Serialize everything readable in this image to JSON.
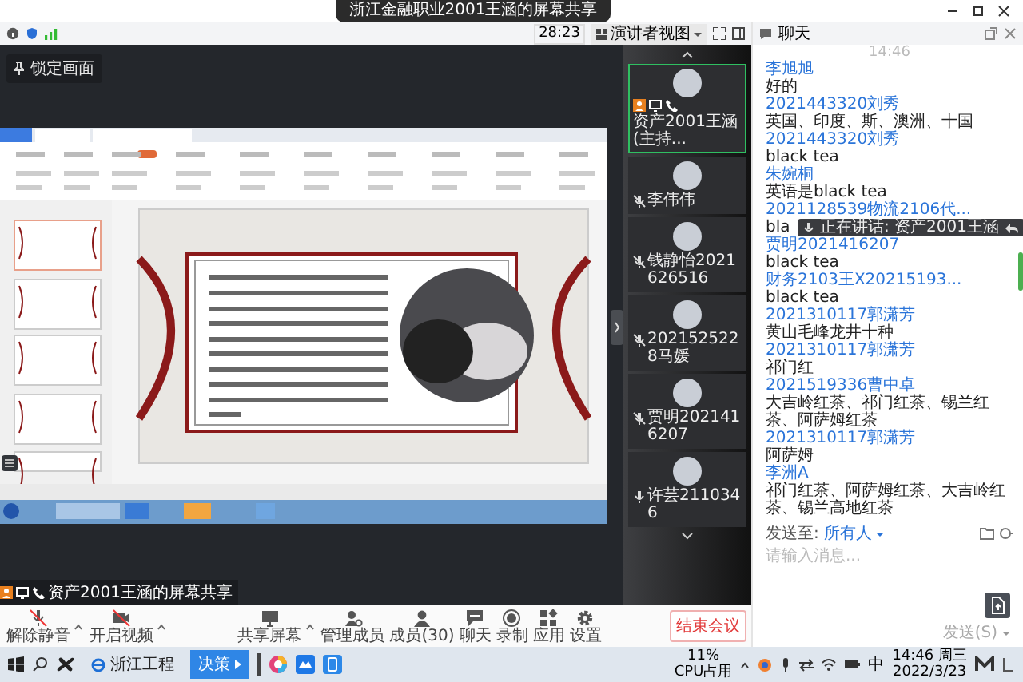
{
  "window": {
    "title": "浙江金融职业2001王涵的屏幕共享"
  },
  "toolbar": {
    "duration": "28:23",
    "view_button": "演讲者视图"
  },
  "stage": {
    "pin_label": "锁定画面",
    "share_label": "资产2001王涵的屏幕共享"
  },
  "participants": [
    {
      "name": "资产2001王涵(主持...",
      "host": true,
      "speaking": true,
      "muted": false
    },
    {
      "name": "李伟伟",
      "host": false,
      "speaking": false,
      "muted": true
    },
    {
      "name": "钱静怡2021626516",
      "host": false,
      "speaking": false,
      "muted": true
    },
    {
      "name": "2021525228马媛",
      "host": false,
      "speaking": false,
      "muted": true
    },
    {
      "name": "贾明2021416207",
      "host": false,
      "speaking": false,
      "muted": true
    },
    {
      "name": "许芸2110346",
      "host": false,
      "speaking": false,
      "muted": false
    }
  ],
  "chat": {
    "title": "聊天",
    "time": "14:46",
    "messages": [
      {
        "sender": "李旭旭",
        "text": "好的"
      },
      {
        "sender": "2021443320刘秀",
        "text": "英国、印度、斯、澳洲、十国"
      },
      {
        "sender": "2021443320刘秀",
        "text": "black tea"
      },
      {
        "sender": "朱婉桐",
        "text": "英语是black tea"
      },
      {
        "sender": "2021128539物流2106代...",
        "text": "bla",
        "notification": "正在讲话: 资产2001王涵"
      },
      {
        "sender": "贾明2021416207",
        "text": "black tea"
      },
      {
        "sender": "财务2103王X20215193...",
        "text": "black tea"
      },
      {
        "sender": "2021310117郭潇芳",
        "text": "黄山毛峰龙井十种"
      },
      {
        "sender": "2021310117郭潇芳",
        "text": "祁门红"
      },
      {
        "sender": "2021519336曹中卓",
        "text": "大吉岭红茶、祁门红茶、锡兰红茶、阿萨姆红茶"
      },
      {
        "sender": "2021310117郭潇芳",
        "text": "阿萨姆"
      },
      {
        "sender": "李洲A",
        "text": "祁门红茶、阿萨姆红茶、大吉岭红茶、锡兰高地红茶"
      }
    ],
    "recipient_label": "发送至:",
    "recipient": "所有人",
    "placeholder": "请输入消息...",
    "send_button": "发送(S)"
  },
  "controls": [
    {
      "kind": "mic_off",
      "label": "解除静音",
      "has_menu": true
    },
    {
      "kind": "video_off",
      "label": "开启视频",
      "has_menu": true
    },
    {
      "kind": "share",
      "label": "共享屏幕",
      "has_menu": true
    },
    {
      "kind": "manage",
      "label": "管理成员",
      "has_menu": false
    },
    {
      "kind": "members",
      "label": "成员(30)",
      "has_menu": false
    },
    {
      "kind": "chat",
      "label": "聊天",
      "has_menu": false
    },
    {
      "kind": "record",
      "label": "录制",
      "has_menu": false
    },
    {
      "kind": "apps",
      "label": "应用",
      "has_menu": false
    },
    {
      "kind": "settings",
      "label": "设置",
      "has_menu": false
    }
  ],
  "end_button": "结束会议",
  "taskbar": {
    "windows": [
      {
        "kind": "browser",
        "label": "浙江工程",
        "active": false
      },
      {
        "kind": "app",
        "label": "决策",
        "active": true
      }
    ],
    "cpu": "11%",
    "cpu_label": "CPU占用",
    "ime": "中",
    "time": "14:46 周三",
    "date": "2022/3/23"
  }
}
